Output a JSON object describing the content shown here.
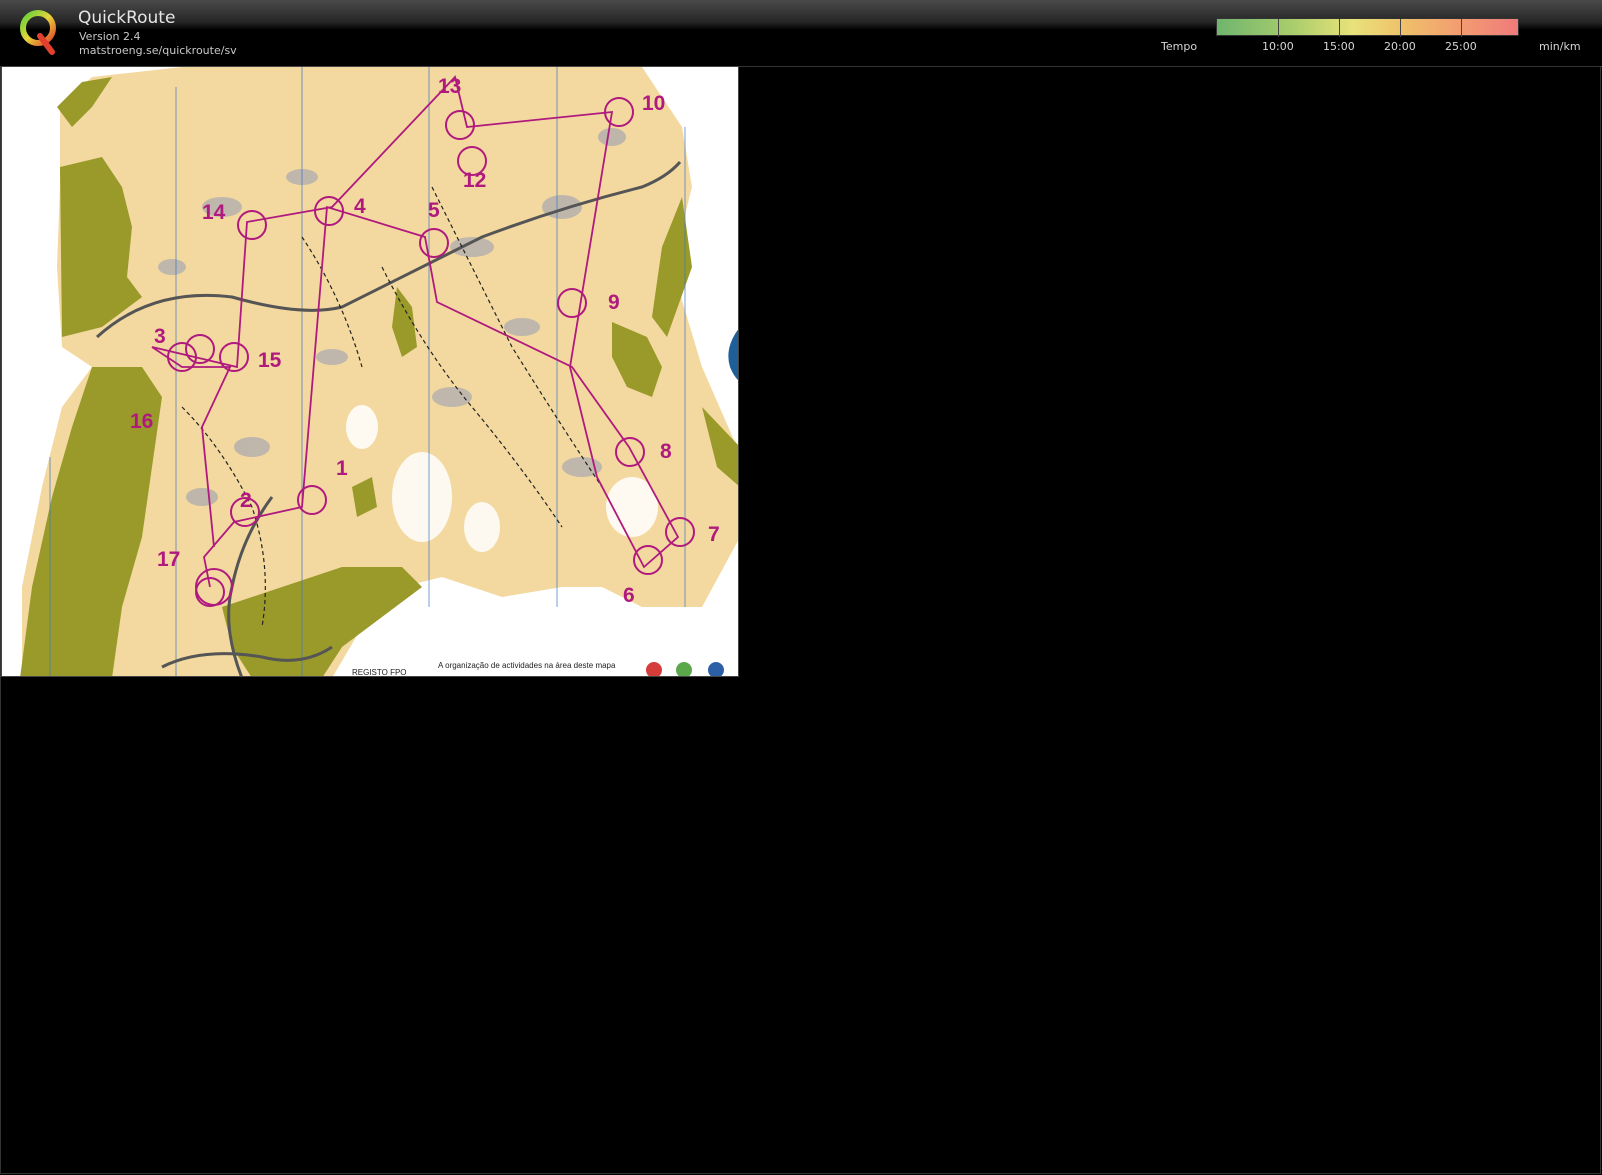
{
  "app": {
    "title": "QuickRoute",
    "version": "Version 2.4",
    "url": "matstroeng.se/quickroute/sv",
    "logo_letter": "Q"
  },
  "legend": {
    "label": "Tempo",
    "ticks": [
      "10:00",
      "15:00",
      "20:00",
      "25:00"
    ],
    "unit": "min/km"
  },
  "map": {
    "controls": [
      "1",
      "2",
      "3",
      "4",
      "5",
      "6",
      "7",
      "8",
      "9",
      "10",
      "12",
      "13",
      "14",
      "15",
      "16",
      "17"
    ],
    "footer_left": "REGISTO FPO",
    "footer_note": "A organização de actividades na área deste mapa"
  },
  "colors": {
    "course": "#b0197e",
    "vegetation": "#9a9a2a",
    "open_land": "#f3d9a0"
  }
}
